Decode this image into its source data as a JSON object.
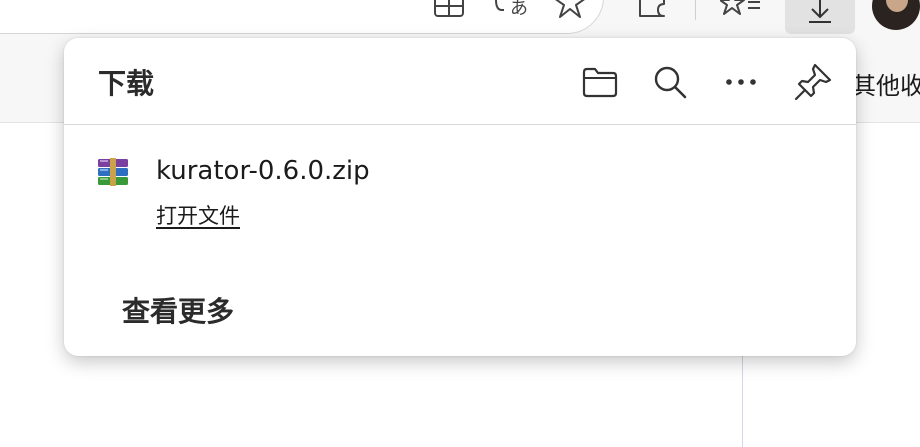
{
  "toolbar": {
    "icons": [
      "split-screen-icon",
      "read-aloud-icon",
      "favorite-star-icon",
      "extensions-icon",
      "favorites-list-icon",
      "downloads-icon",
      "profile-avatar"
    ]
  },
  "favorites_bar": {
    "other_favorites_label": "其他收"
  },
  "downloads": {
    "title": "下载",
    "header_actions": [
      "open-folder-icon",
      "search-icon",
      "more-options-icon",
      "pin-icon"
    ],
    "items": [
      {
        "file_name": "kurator-0.6.0.zip",
        "action_label": "打开文件",
        "file_type_icon": "winrar-archive-icon"
      }
    ],
    "see_more_label": "查看更多"
  },
  "colors": {
    "flyout_bg": "#ffffff",
    "chrome_bg": "#f7f7f7",
    "active_button_bg": "#e2e2e2",
    "text": "#1b1b1b"
  }
}
